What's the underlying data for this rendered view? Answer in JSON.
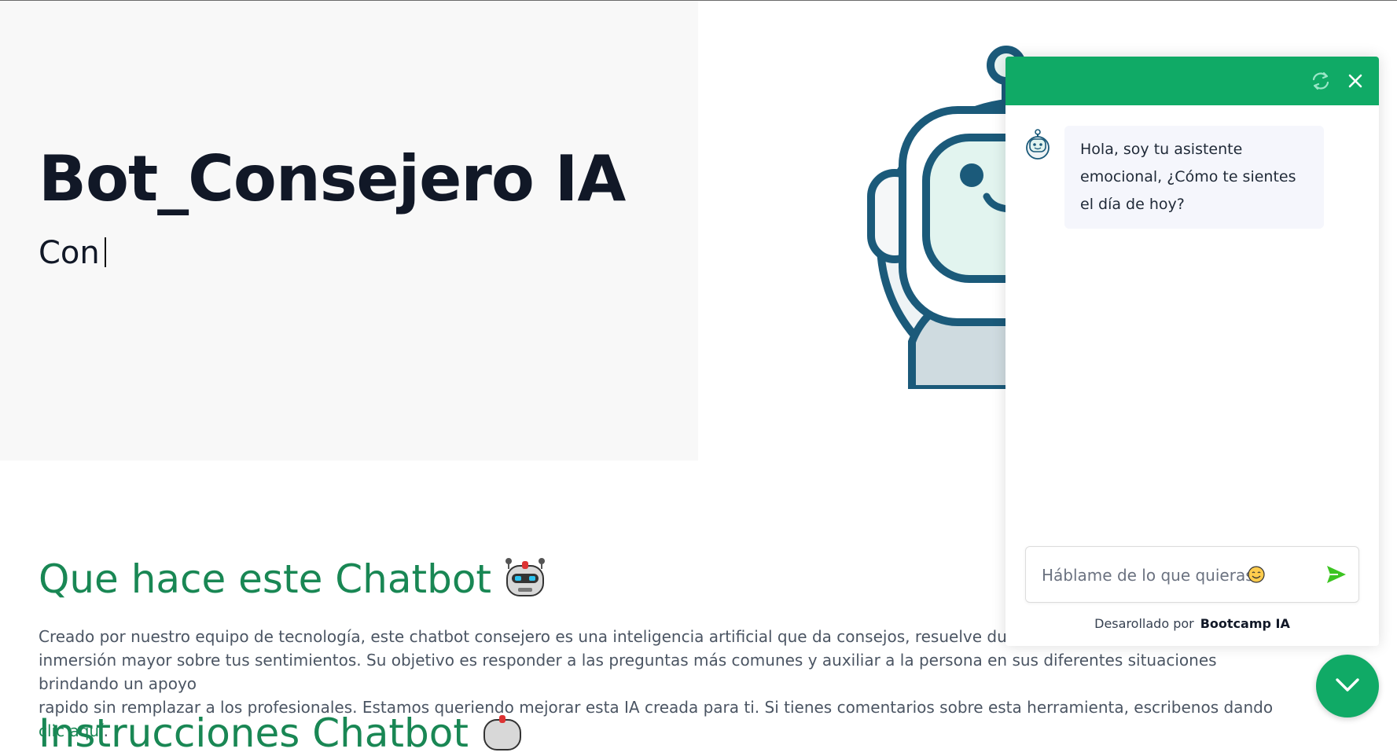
{
  "hero": {
    "title": "Bot_Consejero IA",
    "typed_text": "Con"
  },
  "sections": {
    "what_title": "Que hace este Chatbot",
    "description": "Creado por nuestro equipo de tecnología, este chatbot consejero es una inteligencia artificial que da consejos, resuelve dudas, da eje",
    "description_line2": "inmersión mayor sobre tus sentimientos. Su objetivo es responder a las preguntas más comunes y auxiliar a la persona en sus diferentes situaciones brindando un apoyo",
    "description_line3": "rapido sin remplazar a los profesionales. Estamos queriendo mejorar esta IA creada para ti. Si tienes comentarios sobre esta herramienta, escribenos dando",
    "link_text": "clic aquí",
    "instructions_title": "Instrucciones Chatbot"
  },
  "chat": {
    "bot_message": "Hola, soy tu asistente emocional, ¿Cómo te sientes el día de hoy?",
    "input_placeholder": "Háblame de lo que quieras",
    "footer_prefix": "Desarollado por",
    "footer_brand": "Bootcamp IA"
  },
  "icons": {
    "refresh": "refresh-icon",
    "close": "close-icon",
    "send": "send-icon",
    "toggle": "chevron-down-icon",
    "robot_emoji": "robot-icon"
  },
  "colors": {
    "brand_green": "#10aa66",
    "heading_green": "#198754",
    "robot_blue": "#1b5a7a"
  }
}
